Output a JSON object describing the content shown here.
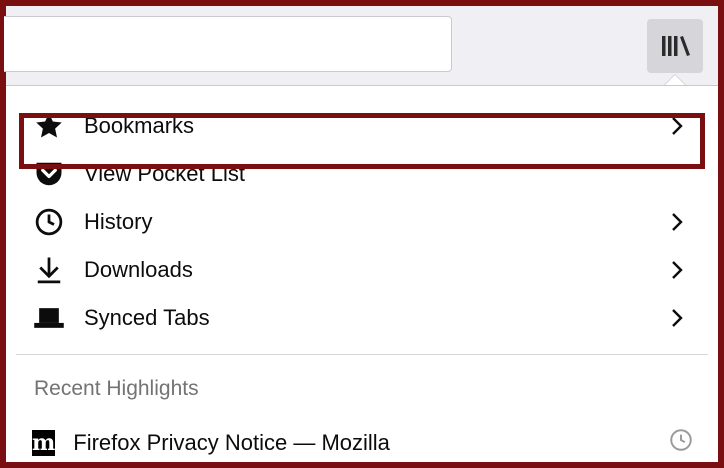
{
  "toolbar": {
    "library_icon": "library-icon"
  },
  "menu": {
    "items": [
      {
        "label": "Bookmarks",
        "icon": "star-icon",
        "has_submenu": true
      },
      {
        "label": "View Pocket List",
        "icon": "pocket-icon",
        "has_submenu": false
      },
      {
        "label": "History",
        "icon": "clock-icon",
        "has_submenu": true
      },
      {
        "label": "Downloads",
        "icon": "download-icon",
        "has_submenu": true
      },
      {
        "label": "Synced Tabs",
        "icon": "laptop-icon",
        "has_submenu": true
      }
    ]
  },
  "recent": {
    "title": "Recent Highlights",
    "items": [
      {
        "label": "Firefox Privacy Notice — Mozilla",
        "favicon_text": "m",
        "icon": "history-clock-icon"
      }
    ]
  },
  "colors": {
    "highlight_border": "#7a0f12",
    "panel_bg": "#ffffff",
    "toolbar_bg": "#f0f0f4"
  }
}
